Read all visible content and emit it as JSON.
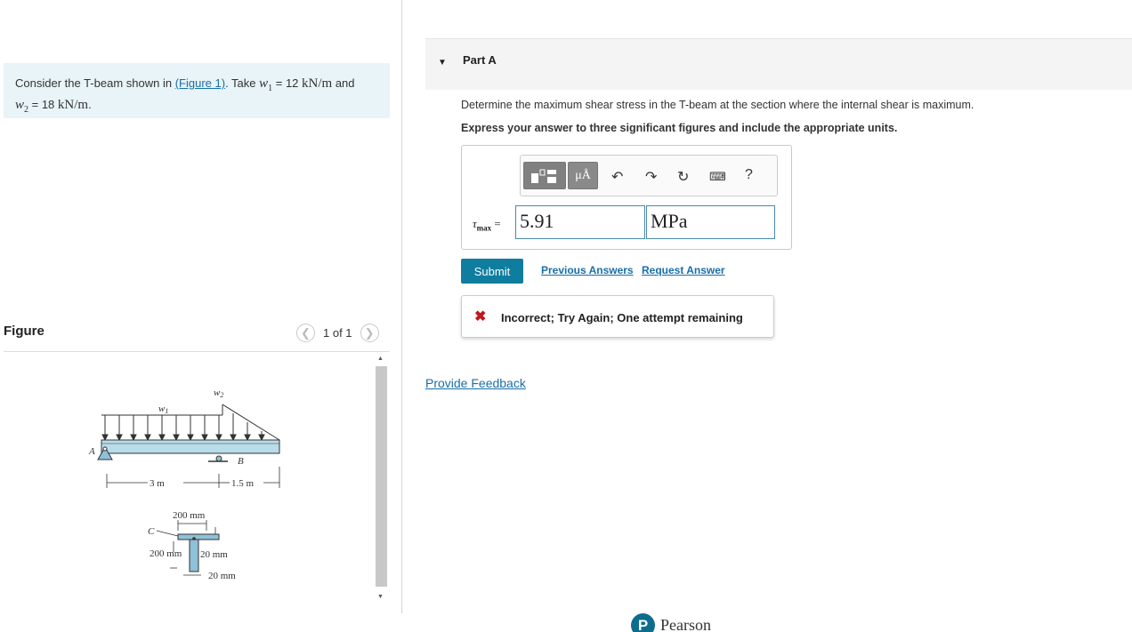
{
  "problem": {
    "text_before": "Consider the T-beam shown in ",
    "figure_link": "(Figure 1)",
    "text_take": ". Take ",
    "w1_sym": "w",
    "w1_sub": "1",
    "w1_value": " = 12 ",
    "w1_unit": "kN/m",
    "and": " and",
    "w2_sym": "w",
    "w2_sub": "2",
    "w2_value": " = 18 ",
    "w2_unit": "kN/m",
    "end": "."
  },
  "figure_panel": {
    "title": "Figure",
    "pager_text": "1 of 1",
    "prev_icon": "chevron-left-icon",
    "next_icon": "chevron-right-icon"
  },
  "figure_labels": {
    "w1": "w",
    "w1_sub": "1",
    "w2": "w",
    "w2_sub": "2",
    "A": "A",
    "B": "B",
    "C": "C",
    "span1": "3 m",
    "span2": "1.5 m",
    "width": "200 mm",
    "height": "200 mm",
    "flange": "20 mm",
    "web": "20 mm"
  },
  "part": {
    "title": "Part A",
    "question": "Determine the maximum shear stress in the T-beam at the section where the internal shear is maximum.",
    "instruction": "Express your answer to three significant figures and include the appropriate units."
  },
  "toolbar": {
    "units_button": "μÅ",
    "help": "?",
    "icons": [
      "templates-icon",
      "units-icon",
      "undo-icon",
      "redo-icon",
      "reset-icon",
      "keyboard-icon",
      "help-icon"
    ]
  },
  "answer": {
    "label_sym": "τ",
    "label_sub": "max",
    "eq": " = ",
    "value": "5.91",
    "units": "MPa"
  },
  "actions": {
    "submit": "Submit",
    "previous_answers": "Previous Answers",
    "request_answer": "Request Answer"
  },
  "feedback": {
    "message": "Incorrect; Try Again; One attempt remaining"
  },
  "provide_feedback": "Provide Feedback",
  "brand": {
    "logo_letter": "P",
    "name": "Pearson"
  }
}
